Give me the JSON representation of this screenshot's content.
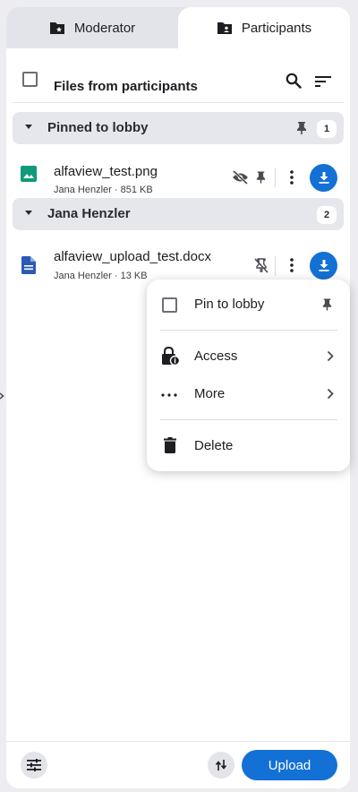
{
  "tabs": [
    {
      "label": "Moderator",
      "icon": "folder-star-icon",
      "active": false
    },
    {
      "label": "Participants",
      "icon": "folder-person-icon",
      "active": true
    }
  ],
  "list_header": {
    "title": "Files from participants",
    "checked": false
  },
  "groups": [
    {
      "title": "Pinned to lobby",
      "count": "1",
      "files": [
        {
          "name": "alfaview_test.png",
          "meta": "Jana Henzler · 851 KB",
          "type": "image"
        }
      ]
    },
    {
      "title": "Jana Henzler",
      "count": "2",
      "files": [
        {
          "name": "alfaview_upload_test.docx",
          "meta": "Jana Henzler · 13 KB",
          "type": "document"
        }
      ]
    }
  ],
  "context_menu": {
    "pin": "Pin to lobby",
    "access": "Access",
    "more": "More",
    "delete": "Delete"
  },
  "footer": {
    "upload_label": "Upload"
  },
  "colors": {
    "accent": "#1371d6",
    "image_icon": "#0f9a7a",
    "doc_icon": "#2a5ab5"
  }
}
